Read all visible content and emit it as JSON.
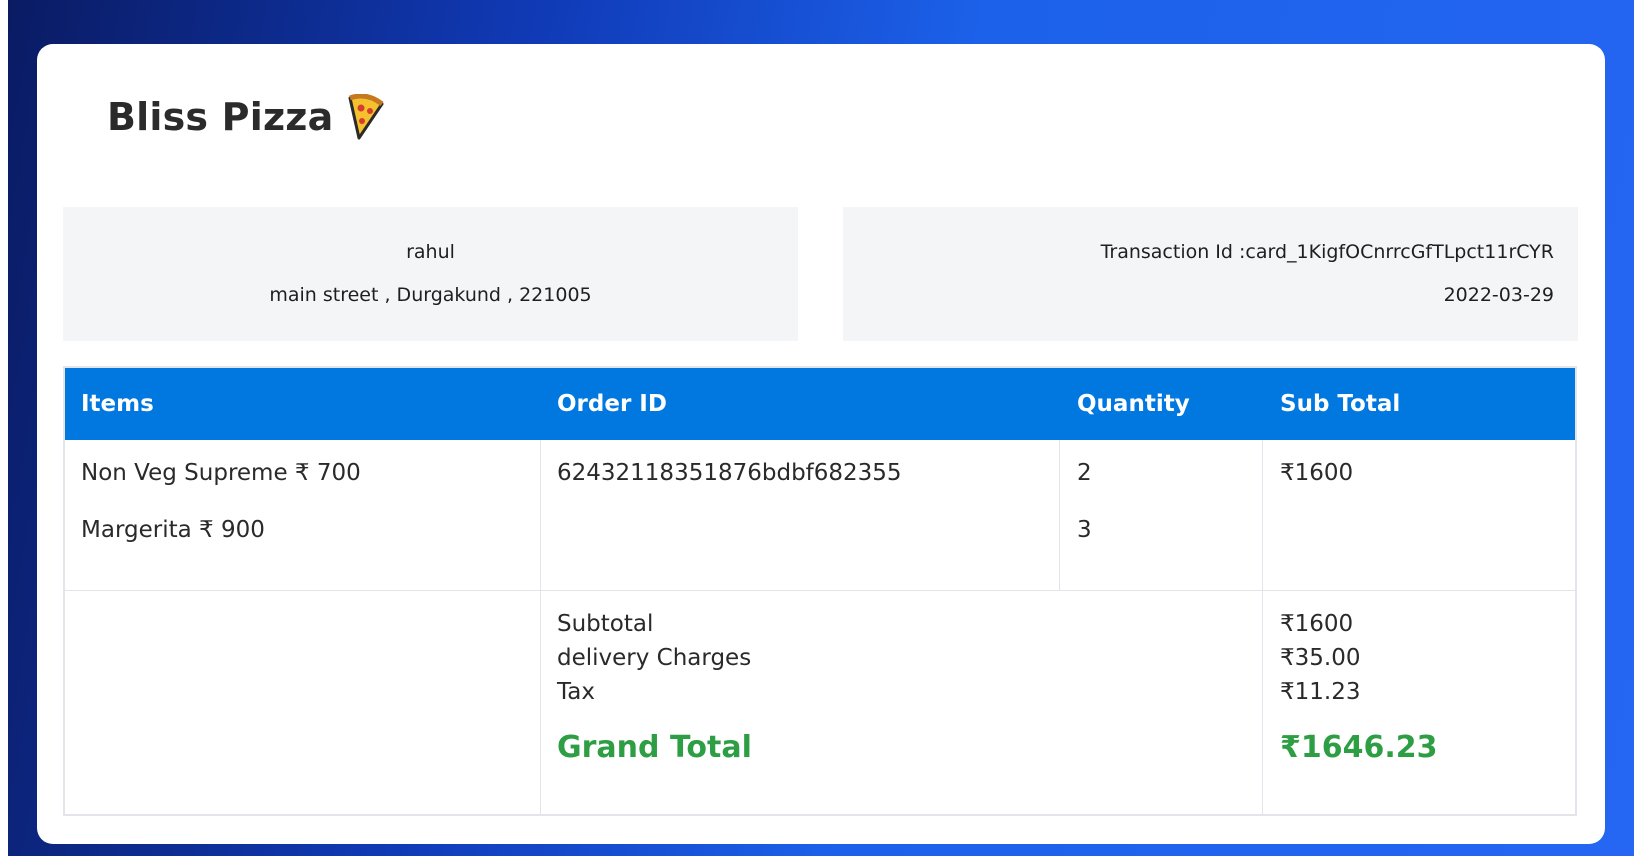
{
  "brand": {
    "name": "Bliss Pizza",
    "icon": "pizza-icon"
  },
  "customer": {
    "name": "rahul",
    "address": "main street , Durgakund , 221005"
  },
  "transaction": {
    "id_text": "Transaction Id :card_1KigfOCnrrcGfTLpct11rCYR",
    "date": "2022-03-29"
  },
  "table": {
    "headers": [
      "Items",
      "Order ID",
      "Quantity",
      "Sub Total"
    ],
    "items": [
      {
        "label": "Non Veg Supreme ₹ 700",
        "quantity": "2"
      },
      {
        "label": "Margerita ₹ 900",
        "quantity": "3"
      }
    ],
    "order_id": "62432118351876bdbf682355",
    "row_subtotal": "₹1600"
  },
  "totals": {
    "subtotal_label": "Subtotal",
    "subtotal_value": "₹1600",
    "delivery_label": "delivery Charges",
    "delivery_value": "₹35.00",
    "tax_label": "Tax",
    "tax_value": "₹11.23",
    "grand_label": "Grand Total",
    "grand_value": "₹1646.23"
  },
  "colors": {
    "header_blue": "#0078e0",
    "grand_total_green": "#2e9e45",
    "background_gradient_start": "#0a1b63",
    "background_gradient_end": "#2566f2"
  }
}
